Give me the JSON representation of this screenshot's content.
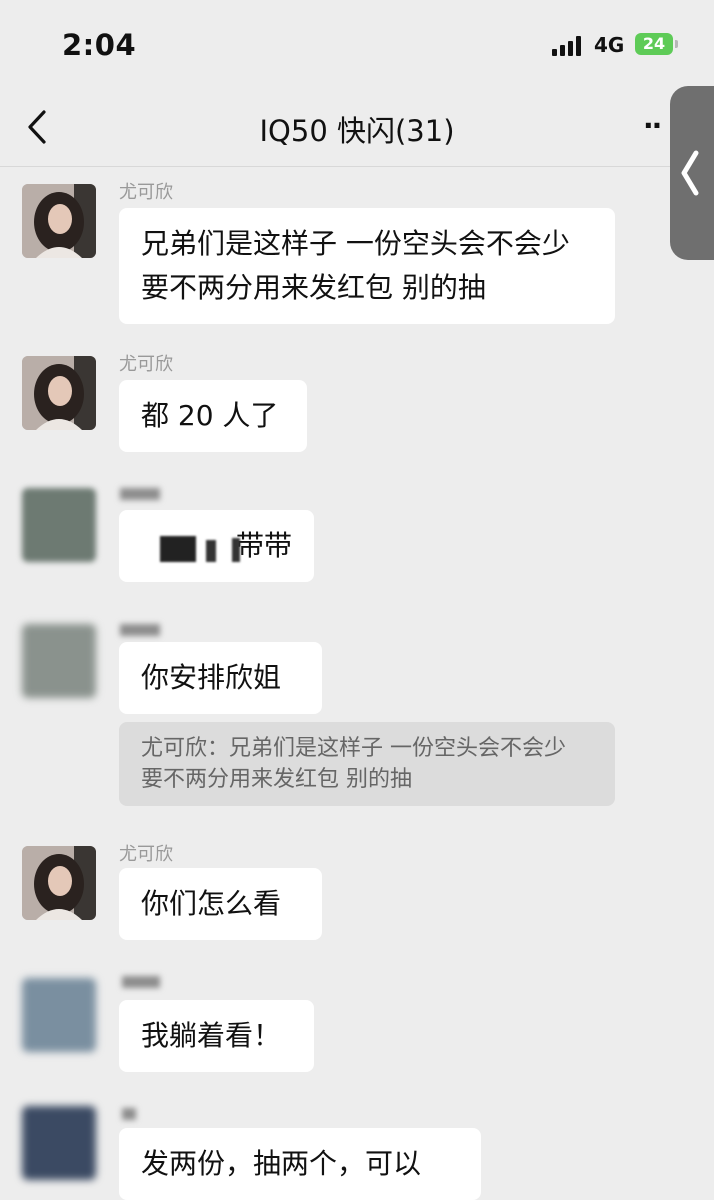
{
  "status_bar": {
    "time": "2:04",
    "network": "4G",
    "battery": "24"
  },
  "nav": {
    "title": "IQ50 快闪(31)",
    "more": "··"
  },
  "messages": [
    {
      "sender": "尤可欣",
      "text": "兄弟们是这样子 一份空头会不会少 要不两分用来发红包 别的抽"
    },
    {
      "sender": "尤可欣",
      "text": "都 20 人了"
    },
    {
      "sender": "",
      "text": "带带"
    },
    {
      "sender": "",
      "text": "你安排欣姐",
      "quote": "尤可欣：兄弟们是这样子 一份空头会不会少 要不两分用来发红包 别的抽"
    },
    {
      "sender": "尤可欣",
      "text": "你们怎么看"
    },
    {
      "sender": "",
      "text": "我躺着看！"
    },
    {
      "sender": "",
      "text": "发两份，抽两个，可以"
    }
  ]
}
